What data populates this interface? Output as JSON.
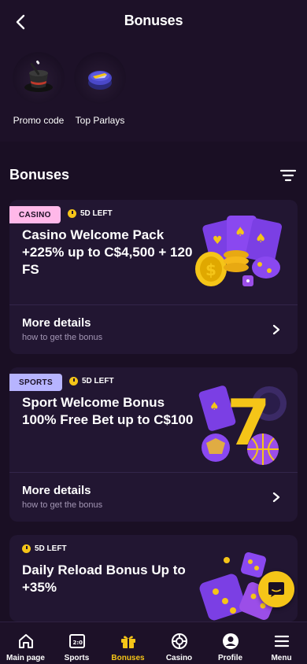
{
  "header": {
    "title": "Bonuses"
  },
  "quick_links": [
    {
      "label": "Promo code",
      "icon": "magic-hat-icon"
    },
    {
      "label": "Top Parlays",
      "icon": "parlay-puck-icon"
    }
  ],
  "section": {
    "title": "Bonuses"
  },
  "cards": [
    {
      "tag": "CASINO",
      "tag_color": "#ffb8e9",
      "timer": "5D LEFT",
      "title": "Casino Welcome Pack +225% up to C$4,500 + 120 FS",
      "more_title": "More details",
      "more_sub": "how to get the bonus"
    },
    {
      "tag": "SPORTS",
      "tag_color": "#b7b4ff",
      "timer": "5D LEFT",
      "title": "Sport Welcome Bonus 100% Free Bet up to C$100",
      "more_title": "More details",
      "more_sub": "how to get the bonus"
    },
    {
      "timer": "5D LEFT",
      "title": "Daily Reload Bonus Up to +35%"
    }
  ],
  "tabbar": [
    {
      "label": "Main page",
      "icon": "home-icon"
    },
    {
      "label": "Sports",
      "icon": "scoreboard-icon"
    },
    {
      "label": "Bonuses",
      "icon": "gift-icon",
      "active": true
    },
    {
      "label": "Casino",
      "icon": "roulette-icon"
    },
    {
      "label": "Profile",
      "icon": "profile-icon"
    },
    {
      "label": "Menu",
      "icon": "menu-icon"
    }
  ],
  "colors": {
    "accent": "#f5c518",
    "background": "#1a0f24",
    "card": "#221632",
    "purple": "#7b3fe4"
  }
}
